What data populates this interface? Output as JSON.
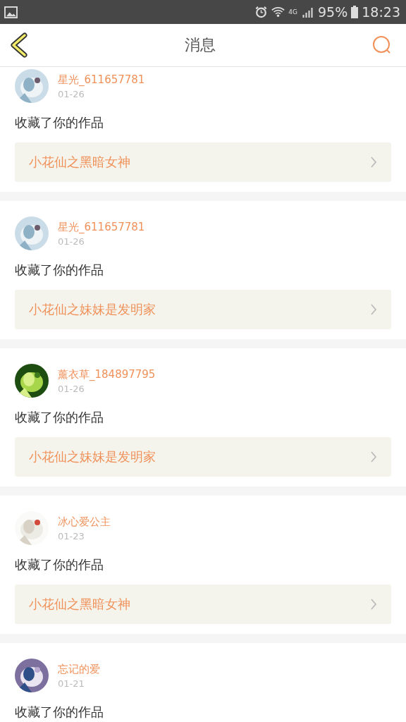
{
  "status_bar": {
    "network": "4G",
    "battery": "95%",
    "time": "18:23"
  },
  "header": {
    "title": "消息"
  },
  "messages": [
    {
      "user": "星光_611657781",
      "date": "01-26",
      "action": "收藏了你的作品",
      "work": "小花仙之黑暗女神"
    },
    {
      "user": "星光_611657781",
      "date": "01-26",
      "action": "收藏了你的作品",
      "work": "小花仙之妹妹是发明家"
    },
    {
      "user": "薰衣草_184897795",
      "date": "01-26",
      "action": "收藏了你的作品",
      "work": "小花仙之妹妹是发明家"
    },
    {
      "user": "冰心爱公主",
      "date": "01-23",
      "action": "收藏了你的作品",
      "work": "小花仙之黑暗女神"
    },
    {
      "user": "忘记的爱",
      "date": "01-21",
      "action": "收藏了你的作品"
    }
  ]
}
